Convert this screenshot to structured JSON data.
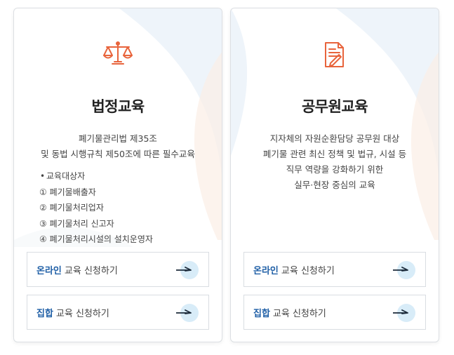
{
  "cards": [
    {
      "icon": "scales-icon",
      "title": "법정교육",
      "description": [
        "폐기물관리법 제35조",
        "및 동법 시행규칙 제50조에 따른 필수교육"
      ],
      "targets_heading": "교육대상자",
      "targets": [
        "① 폐기물배출자",
        "② 폐기물처리업자",
        "③ 폐기물처리 신고자",
        "④ 폐기물처리시설의 설치운영자"
      ],
      "buttons": [
        {
          "keyword": "온라인",
          "label": "교육 신청하기"
        },
        {
          "keyword": "집합",
          "label": "교육 신청하기"
        }
      ]
    },
    {
      "icon": "document-pen-icon",
      "title": "공무원교육",
      "description": [
        "지자체의 자원순환담당 공무원 대상",
        "폐기물 관련 최신 정책 및 법규, 시설 등",
        "직무 역량을 강화하기 위한",
        "실무·현장 중심의 교육"
      ],
      "buttons": [
        {
          "keyword": "온라인",
          "label": "교육 신청하기"
        },
        {
          "keyword": "집합",
          "label": "교육 신청하기"
        }
      ]
    }
  ],
  "colors": {
    "accent_icon": "#e8643c",
    "button_keyword": "#1f5fa6",
    "arrow_circle": "#d8ecf8"
  }
}
